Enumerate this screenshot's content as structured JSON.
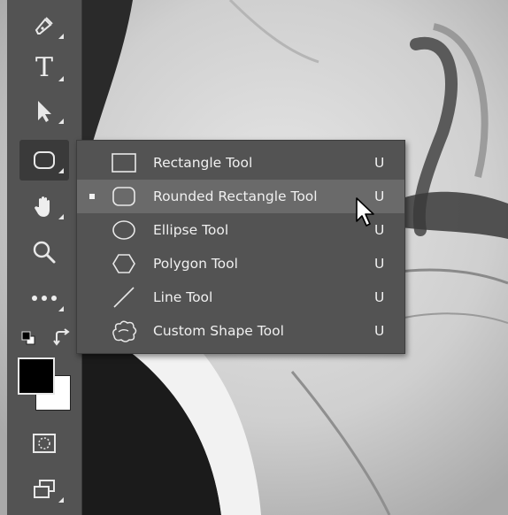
{
  "toolbar": {
    "tools": [
      {
        "id": "pen",
        "icon": "pen-icon"
      },
      {
        "id": "type",
        "icon": "type-icon",
        "glyph": "T"
      },
      {
        "id": "path-selection",
        "icon": "path-selection-arrow-icon"
      },
      {
        "id": "shape",
        "icon": "rounded-rectangle-icon",
        "active": true
      },
      {
        "id": "hand",
        "icon": "hand-icon"
      },
      {
        "id": "zoom",
        "icon": "zoom-magnifier-icon"
      },
      {
        "id": "more",
        "icon": "more-tools-icon"
      },
      {
        "id": "default-colors",
        "icon": "default-colors-icon"
      },
      {
        "id": "swap-colors",
        "icon": "swap-colors-icon"
      },
      {
        "id": "foreground-color",
        "color": "#000000"
      },
      {
        "id": "background-color",
        "color": "#ffffff"
      },
      {
        "id": "quick-mask",
        "icon": "quick-mask-icon"
      },
      {
        "id": "screen-mode",
        "icon": "screen-mode-icon"
      }
    ]
  },
  "flyout": {
    "items": [
      {
        "label": "Rectangle Tool",
        "shortcut": "U",
        "icon": "rectangle-icon",
        "selected": false,
        "hovered": false
      },
      {
        "label": "Rounded Rectangle Tool",
        "shortcut": "U",
        "icon": "rounded-rectangle-icon",
        "selected": true,
        "hovered": true
      },
      {
        "label": "Ellipse Tool",
        "shortcut": "U",
        "icon": "ellipse-icon",
        "selected": false,
        "hovered": false
      },
      {
        "label": "Polygon Tool",
        "shortcut": "U",
        "icon": "polygon-icon",
        "selected": false,
        "hovered": false
      },
      {
        "label": "Line Tool",
        "shortcut": "U",
        "icon": "line-icon",
        "selected": false,
        "hovered": false
      },
      {
        "label": "Custom Shape Tool",
        "shortcut": "U",
        "icon": "custom-shape-icon",
        "selected": false,
        "hovered": false
      }
    ]
  },
  "colors": {
    "toolbar_bg": "#535353",
    "menu_bg": "#535353",
    "menu_highlight": "#6a6a6a",
    "text": "#f0f0f0"
  }
}
